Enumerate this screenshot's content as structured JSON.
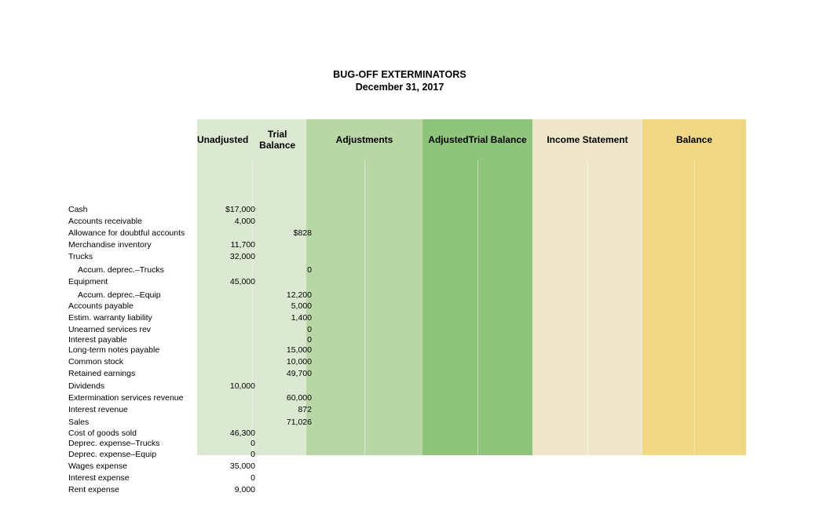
{
  "document": {
    "title": "BUG-OFF EXTERMINATORS",
    "date": "December 31, 2017"
  },
  "columns": [
    {
      "key": "account",
      "label": "",
      "color": "#ffffff"
    },
    {
      "key": "unadj",
      "label": "Unadjusted\nTrial Balance",
      "line1": "Unadjusted",
      "line2": "Trial Balance",
      "color": "#dce9d2"
    },
    {
      "key": "adj",
      "label": "Adjustments",
      "line1": "Adjustments",
      "line2": "",
      "color": "#b9d6a7"
    },
    {
      "key": "adjtb",
      "label": "Adjusted\nTrial Balance",
      "line1": "Adjusted",
      "line2": "Trial Balance",
      "color": "#8fc47d"
    },
    {
      "key": "incstmt",
      "label": "Income Statement",
      "line1": "Income Statement",
      "line2": "",
      "color": "#efe6c9"
    },
    {
      "key": "balance",
      "label": "Balance",
      "line1": "Balance",
      "line2": "",
      "color": "#f1d884"
    }
  ],
  "rows": [
    {
      "account": "Cash",
      "indent": false,
      "debit": "$17,000",
      "credit": ""
    },
    {
      "account": "Accounts receivable",
      "indent": false,
      "debit": "4,000",
      "credit": ""
    },
    {
      "account": "Allowance for   doubtful accounts",
      "indent": false,
      "debit": "",
      "credit": "$828"
    },
    {
      "account": "Merchandise inventory",
      "indent": false,
      "debit": "11,700",
      "credit": ""
    },
    {
      "account": "Trucks",
      "indent": false,
      "debit": "32,000",
      "credit": ""
    },
    {
      "account": "Accum. deprec.–Trucks",
      "indent": true,
      "debit": "",
      "credit": "0"
    },
    {
      "account": "Equipment",
      "indent": false,
      "debit": "45,000",
      "credit": ""
    },
    {
      "account": "Accum. deprec.–Equip",
      "indent": true,
      "debit": "",
      "credit": "12,200"
    },
    {
      "account": "Accounts payable",
      "indent": false,
      "debit": "",
      "credit": "5,000"
    },
    {
      "account": "Estim. warranty liability",
      "indent": false,
      "debit": "",
      "credit": "1,400"
    },
    {
      "account": "Unearned services rev",
      "indent": false,
      "debit": "",
      "credit": "0"
    },
    {
      "account": "Interest  payable",
      "indent": false,
      "debit": "",
      "credit": "0"
    },
    {
      "account": "Long-term notes payable",
      "indent": false,
      "debit": "",
      "credit": "15,000"
    },
    {
      "account": "Common stock",
      "indent": false,
      "debit": "",
      "credit": "10,000"
    },
    {
      "account": "Retained earnings",
      "indent": false,
      "debit": "",
      "credit": "49,700"
    },
    {
      "account": "Dividends",
      "indent": false,
      "debit": "10,000",
      "credit": ""
    },
    {
      "account": "Extermination   services revenue",
      "indent": false,
      "debit": "",
      "credit": "60,000"
    },
    {
      "account": "Interest revenue",
      "indent": false,
      "debit": "",
      "credit": "872"
    },
    {
      "account": "Sales",
      "indent": false,
      "debit": "",
      "credit": "71,026"
    },
    {
      "account": "Cost of goods sold",
      "indent": false,
      "debit": "46,300",
      "credit": ""
    },
    {
      "account": "Deprec. expense–Trucks",
      "indent": false,
      "debit": "0",
      "credit": ""
    },
    {
      "account": "Deprec. expense–Equip",
      "indent": false,
      "debit": "0",
      "credit": ""
    },
    {
      "account": "Wages expense",
      "indent": false,
      "debit": "35,000",
      "credit": ""
    },
    {
      "account": "Interest expense",
      "indent": false,
      "debit": "0",
      "credit": ""
    },
    {
      "account": "Rent expense",
      "indent": false,
      "debit": "9,000",
      "credit": ""
    }
  ],
  "layout": {
    "col_x": {
      "account": 0,
      "unadj": 196,
      "adj": 335,
      "adjtb": 483,
      "incstmt": 623,
      "balance": 763,
      "end": 895
    },
    "row_tops": [
      56,
      71,
      86,
      101,
      116,
      133,
      148,
      165,
      179,
      194,
      209,
      222,
      235,
      250,
      265,
      281,
      296,
      311,
      327,
      341,
      354,
      368,
      383,
      398,
      413
    ]
  }
}
